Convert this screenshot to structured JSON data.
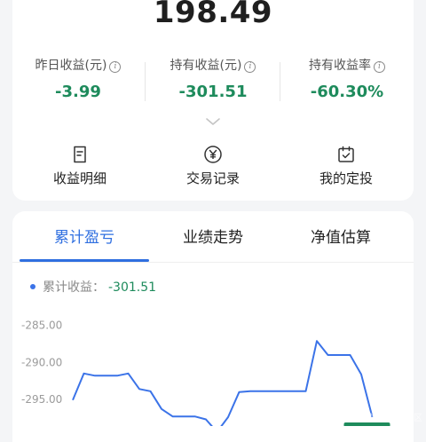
{
  "header": {
    "amount": "198.49"
  },
  "stats": [
    {
      "label": "昨日收益(元)",
      "value": "-3.99"
    },
    {
      "label": "持有收益(元)",
      "value": "-301.51"
    },
    {
      "label": "持有收益率",
      "value": "-60.30%"
    }
  ],
  "actions": [
    {
      "label": "收益明细",
      "icon": "receipt-icon"
    },
    {
      "label": "交易记录",
      "icon": "yen-circle-icon"
    },
    {
      "label": "我的定投",
      "icon": "calendar-check-icon"
    }
  ],
  "tabs": [
    {
      "label": "累计盈亏",
      "active": true
    },
    {
      "label": "业绩走势",
      "active": false
    },
    {
      "label": "净值估算",
      "active": false
    }
  ],
  "legend": {
    "label": "累计收益：",
    "value": "-301.51"
  },
  "colors": {
    "accent": "#2f6fe0",
    "gain_negative": "#1e8b5c",
    "line": "#3b73e8"
  },
  "chart_data": {
    "type": "line",
    "ylim": [
      -298.6,
      -283.0
    ],
    "y_ticks": [
      "-285.00",
      "-290.00",
      "-295.00"
    ],
    "y_tick_values": [
      -285,
      -290,
      -295
    ],
    "series": [
      {
        "values": [
          -295.1,
          -291.5,
          -291.8,
          -291.8,
          -291.8,
          -291.5,
          -293.6,
          -293.9,
          -296.3,
          -297.3,
          -297.3,
          -297.3,
          -297.7,
          -299.4,
          -297.4,
          -294.0,
          -293.9,
          -293.9,
          -293.9,
          -293.9,
          -293.9,
          -293.9,
          -287.1,
          -289.0,
          -289.0,
          -289.0,
          -291.6,
          -297.4
        ]
      }
    ],
    "end_label": "-301.51"
  }
}
